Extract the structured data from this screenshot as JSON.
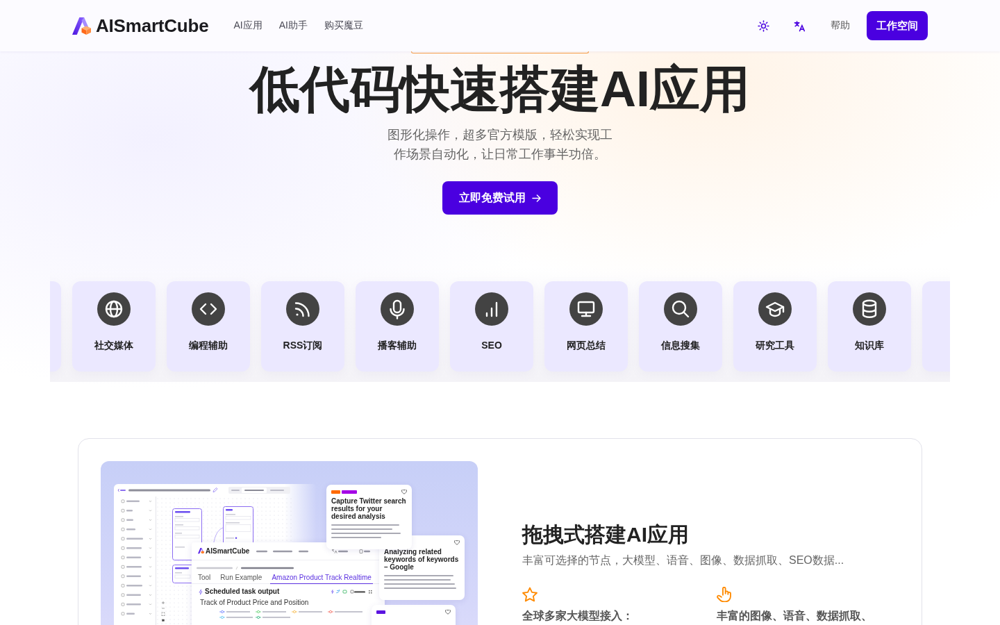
{
  "header": {
    "logo_text": "AISmartCube",
    "nav": [
      {
        "label": "AI应用"
      },
      {
        "label": "AI助手"
      },
      {
        "label": "购买魔豆"
      }
    ],
    "help": "帮助",
    "workspace_button": "工作空间"
  },
  "hero": {
    "title": "低代码快速搭建AI应用",
    "subtitle": "图形化操作，超多官方模版，轻松实现工作场景自动化，让日常工作事半功倍。",
    "cta": "立即免费试用"
  },
  "categories": [
    {
      "label": "社交媒体"
    },
    {
      "label": "编程辅助"
    },
    {
      "label": "RSS订阅"
    },
    {
      "label": "播客辅助"
    },
    {
      "label": "SEO"
    },
    {
      "label": "网页总结"
    },
    {
      "label": "信息搜集"
    },
    {
      "label": "研究工具"
    },
    {
      "label": "知识库"
    }
  ],
  "feature": {
    "title": "拖拽式搭建AI应用",
    "subtitle": "丰富可选择的节点，大模型、语音、图像、数据抓取、SEO数据...",
    "points": [
      {
        "text": "全球多家大模型接入："
      },
      {
        "text": "丰富的图像、语音、数据抓取、"
      }
    ],
    "preview": {
      "site": {
        "logo_text": "AISmartCube",
        "tabs": [
          {
            "label": "Tool",
            "selected": false
          },
          {
            "label": "Run Example",
            "selected": false
          },
          {
            "label": "Amazon Product Track Realtime",
            "selected": true
          }
        ],
        "section_title": "Scheduled task output",
        "chart_title": "Track of Product Price and Position"
      },
      "cards": [
        {
          "title": "Capture Twitter search results for your desired analysis"
        },
        {
          "title": "Analyzing related keywords of keywords – Google"
        }
      ]
    }
  }
}
